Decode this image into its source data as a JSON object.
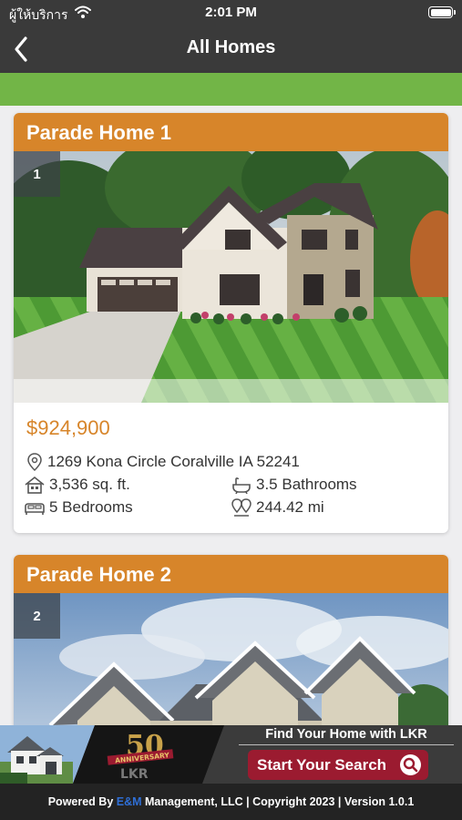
{
  "status_bar": {
    "carrier": "ผู้ให้บริการ",
    "time": "2:01 PM"
  },
  "nav": {
    "title": "All Homes"
  },
  "homes": [
    {
      "title": "Parade Home 1",
      "index": "1",
      "price": "$924,900",
      "address": "1269 Kona Circle Coralville IA 52241",
      "sqft": "3,536 sq. ft.",
      "bathrooms": "3.5 Bathrooms",
      "bedrooms": "5 Bedrooms",
      "distance": "244.42 mi"
    },
    {
      "title": "Parade Home 2",
      "index": "2"
    }
  ],
  "banner": {
    "find_text": "Find Your Home with LKR",
    "start_label": "Start Your Search",
    "logo_number": "50",
    "logo_ribbon": "ANNIVERSARY",
    "logo_letters": "LKR"
  },
  "footer": {
    "prefix": "Powered By ",
    "company_highlight": "E&M",
    "suffix": " Management, LLC | Copyright 2023 | Version 1.0.1"
  },
  "colors": {
    "header_bg": "#3a3a3a",
    "accent_green": "#72b547",
    "card_header": "#d7852a",
    "price": "#d7852a",
    "cta": "#9b1b30"
  },
  "icons": [
    "back-chevron-icon",
    "wifi-icon",
    "battery-icon",
    "location-pin-icon",
    "house-icon",
    "bathtub-icon",
    "bed-icon",
    "map-pins-icon",
    "search-icon"
  ]
}
